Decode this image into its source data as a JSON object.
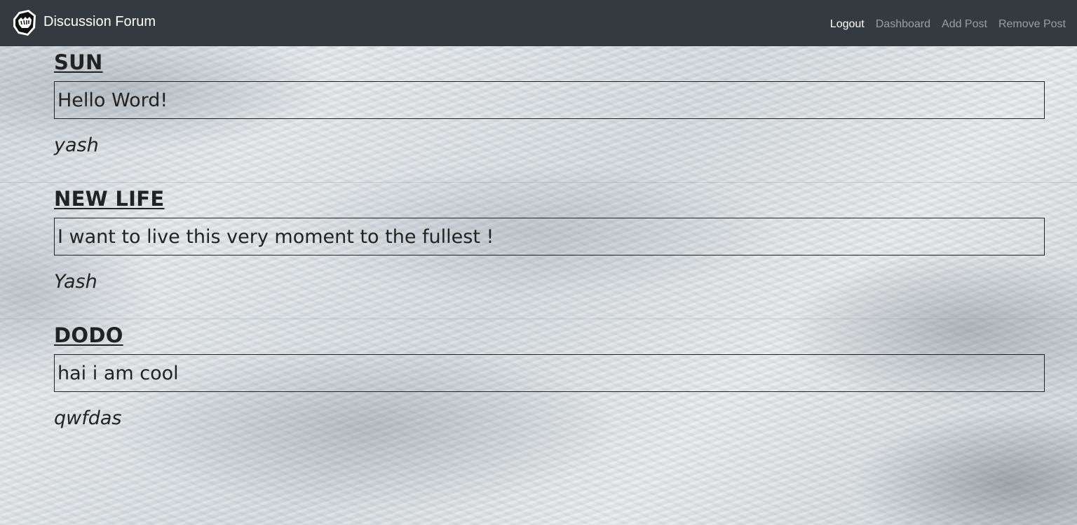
{
  "navbar": {
    "brand_icon": "riot-fist-logo-icon",
    "brand_text": "Discussion Forum",
    "links": [
      {
        "label": "Logout",
        "active": true
      },
      {
        "label": "Dashboard",
        "active": false
      },
      {
        "label": "Add Post",
        "active": false
      },
      {
        "label": "Remove Post",
        "active": false
      }
    ],
    "colors": {
      "background": "#343a40",
      "active_link": "#ffffff",
      "inactive_link": "#9a9da0"
    }
  },
  "posts": [
    {
      "title": "SUN",
      "body": "Hello Word!",
      "author": "yash"
    },
    {
      "title": "NEW LIFE",
      "body": "I want to live this very moment to the fullest !",
      "author": "Yash"
    },
    {
      "title": "DODO",
      "body": "hai i am cool",
      "author": "qwfdas"
    }
  ]
}
